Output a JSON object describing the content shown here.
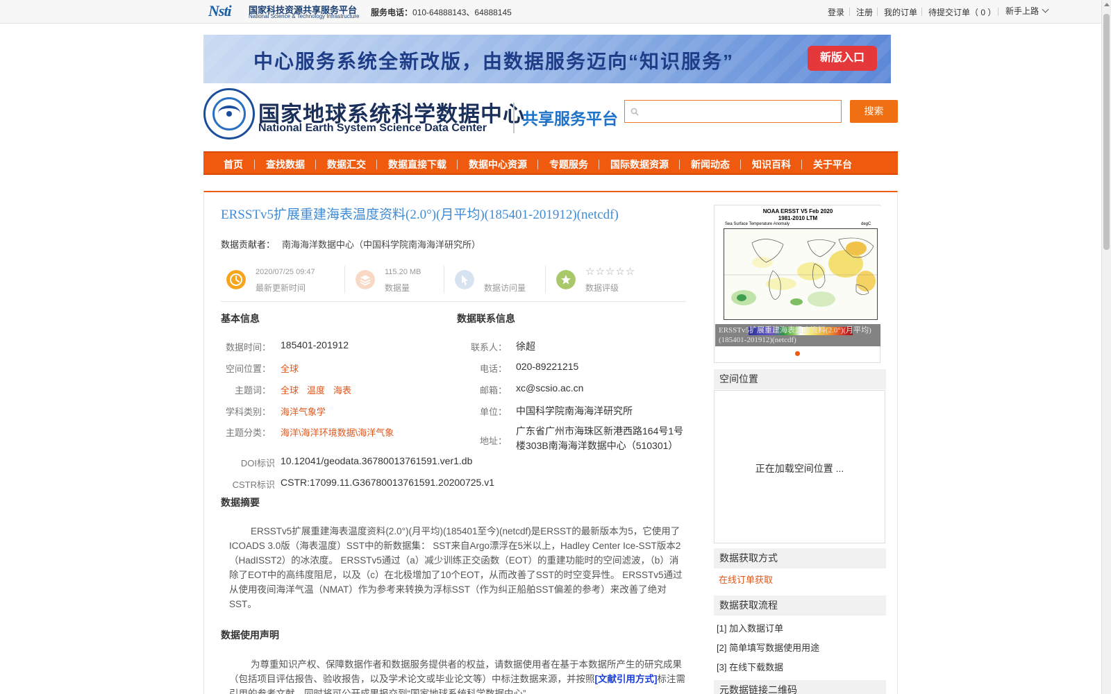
{
  "topbar": {
    "logo_mark": "Nsti",
    "logo_cn": "国家科技资源共享服务平台",
    "logo_en": "National Science & Technology Infrastructure",
    "phone_label": "服务电话：",
    "phone_numbers": "010-64888143、64888145",
    "links": {
      "login": "登录",
      "register": "注册",
      "my_orders": "我的订单",
      "pending_orders": "待提交订单（ 0 ）",
      "newbie": "新手上路"
    }
  },
  "banner": {
    "text": "中心服务系统全新改版，由数据服务迈向“知识服务”",
    "button": "新版入口"
  },
  "header": {
    "center_cn": "国家地球系统科学数据中心",
    "center_en": "National Earth System Science Data Center",
    "platform": "共享服务平台",
    "search_placeholder": "",
    "search_button": "搜索"
  },
  "nav": [
    "首页",
    "查找数据",
    "数据汇交",
    "数据直接下载",
    "数据中心资源",
    "专题服务",
    "国际数据资源",
    "新闻动态",
    "知识百科",
    "关于平台"
  ],
  "dataset": {
    "title": "ERSSTv5扩展重建海表温度资料(2.0°)(月平均)(185401-201912)(netcdf)",
    "contributor_label": "数据贡献者：",
    "contributor": "南海海洋数据中心（中国科学院南海海洋研究所）"
  },
  "stats": {
    "updated_value": "2020/07/25 09:47",
    "updated_label": "最新更新时间",
    "size_value": "115.20 MB",
    "size_label": "数据量",
    "visits_label": "数据访问量",
    "rating_stars": "☆☆☆☆☆",
    "rating_label": "数据评级"
  },
  "basic_info": {
    "heading": "基本信息",
    "time_label": "数据时间：",
    "time_value": "185401-201912",
    "space_label": "空间位置：",
    "space_value": "全球",
    "keywords_label": "主题词：",
    "keywords": [
      "全球",
      "温度",
      "海表"
    ],
    "discipline_label": "学科类别：",
    "discipline_value": "海洋气象学",
    "category_label": "主题分类：",
    "category_value": "海洋\\海洋环境数据\\海洋气象",
    "doi_label": "DOI标识",
    "doi_value": "10.12041/geodata.36780013761591.ver1.db",
    "cstr_label": "CSTR标识",
    "cstr_value": "CSTR:17099.11.G36780013761591.20200725.v1"
  },
  "contact_info": {
    "heading": "数据联系信息",
    "person_label": "联系人：",
    "person_value": "徐超",
    "phone_label": "电话：",
    "phone_value": "020-89221215",
    "email_label": "邮箱：",
    "email_value": "xc@scsio.ac.cn",
    "unit_label": "单位：",
    "unit_value": "中国科学院南海海洋研究所",
    "address_label": "地址：",
    "address_value": "广东省广州市海珠区新港西路164号1号楼303B南海海洋数据中心（510301）"
  },
  "abstract": {
    "heading": "数据摘要",
    "text": "ERSSTv5扩展重建海表温度资料(2.0°)(月平均)(185401至今)(netcdf)是ERSST的最新版本为5，它使用了ICOADS 3.0版（海表温度）SST中的新数据集： SST来自Argo漂浮在5米以上，Hadley Center Ice-SST版本2（HadISST2）的冰浓度。 ERSSTv5通过（a）减少训练正交函数（EOT）的重建功能时的空间滤波，（b）消除了EOT中的高纬度阻尼，以及（c）在北极增加了10个EOT，从而改善了SST的时空变异性。 ERSSTv5通过从使用夜间海洋气温（NMAT）作为参考来转换为浮标SST（作为纠正船舶SST偏差的参考）来改善了绝对SST。"
  },
  "usage": {
    "heading": "数据使用声明",
    "text_before": "为尊重知识产权、保障数据作者和数据服务提供者的权益，请数据使用者在基于本数据所产生的研究成果（包括项目评估报告、验收报告，以及学术论文或毕业论文等）中标注数据来源，并按照",
    "link": "[文献引用方式]",
    "text_after": "标注需引用的参考文献，同时将可公开成果报交到“国家地球系统科学数据中心”。"
  },
  "preview": {
    "map_title": "NOAA ERSST V5 Feb 2020",
    "map_title2": "1981-2010 LTM",
    "map_subtitle": "Sea Surface Temperature Anomaly",
    "map_unit": "degC",
    "caption": "ERSSTv5扩展重建海表温度资料(2.0°)(月平均)(185401-201912)(netcdf)"
  },
  "sidebar": {
    "spatial_heading": "空间位置",
    "loading": "正在加载空间位置 ...",
    "access_heading": "数据获取方式",
    "access_link": "在线订单获取",
    "process_heading": "数据获取流程",
    "steps": [
      "[1] 加入数据订单",
      "[2] 简单填写数据使用用途",
      "[3] 在线下载数据"
    ],
    "qr_heading": "元数据链接二维码"
  },
  "colors": {
    "accent_orange": "#ef5a0e",
    "title_blue": "#3f8bd4",
    "link_orange": "#e0561a"
  }
}
